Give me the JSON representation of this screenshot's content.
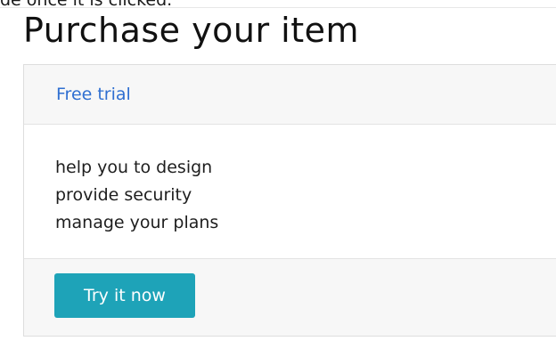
{
  "top_cut_text": "de once it is clicked.",
  "page_title": "Purchase your item",
  "card": {
    "header_link": "Free trial",
    "features": [
      "help you to design",
      "provide security",
      "manage your plans"
    ],
    "button_label": "Try it now"
  },
  "colors": {
    "link": "#2f6fd1",
    "button_bg": "#1ea3b8",
    "button_text": "#ffffff",
    "card_header_bg": "#f7f7f7"
  }
}
